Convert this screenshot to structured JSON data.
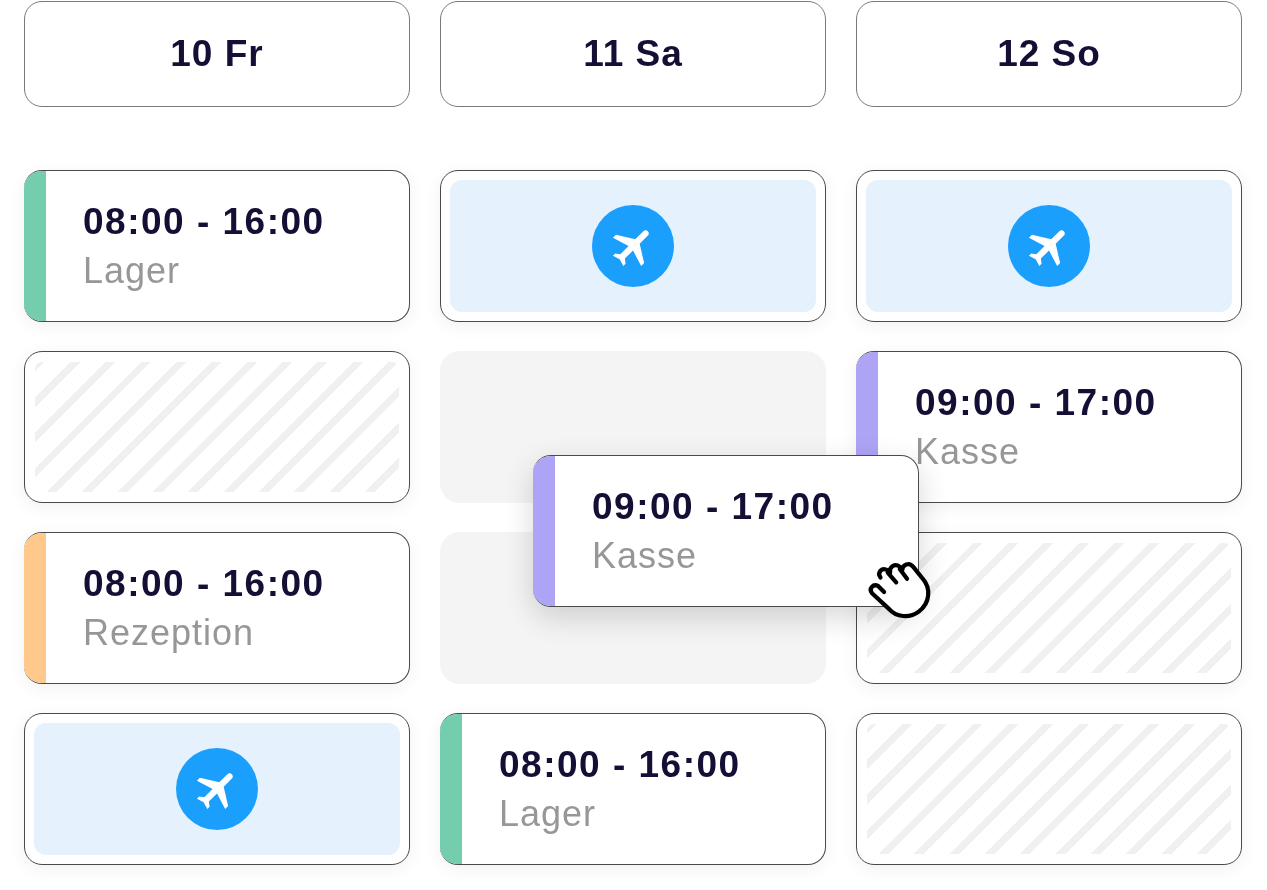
{
  "days": [
    {
      "label": "10 Fr"
    },
    {
      "label": "11 Sa"
    },
    {
      "label": "12 So"
    }
  ],
  "rows": [
    {
      "cells": [
        {
          "kind": "shift",
          "time": "08:00 - 16:00",
          "label": "Lager",
          "color": "#74cdac"
        },
        {
          "kind": "vacation"
        },
        {
          "kind": "vacation"
        }
      ]
    },
    {
      "cells": [
        {
          "kind": "unavailable"
        },
        {
          "kind": "empty"
        },
        {
          "kind": "shift",
          "time": "09:00 - 17:00",
          "label": "Kasse",
          "color": "#ada4f5"
        }
      ]
    },
    {
      "cells": [
        {
          "kind": "shift",
          "time": "08:00 - 16:00",
          "label": "Rezeption",
          "color": "#ffc98c"
        },
        {
          "kind": "empty"
        },
        {
          "kind": "unavailable"
        }
      ]
    },
    {
      "cells": [
        {
          "kind": "vacation"
        },
        {
          "kind": "shift",
          "time": "08:00 - 16:00",
          "label": "Lager",
          "color": "#74cdac"
        },
        {
          "kind": "unavailable"
        }
      ]
    }
  ],
  "dragged_shift": {
    "kind": "shift",
    "time": "09:00 - 17:00",
    "label": "Kasse",
    "color": "#ada4f5"
  }
}
